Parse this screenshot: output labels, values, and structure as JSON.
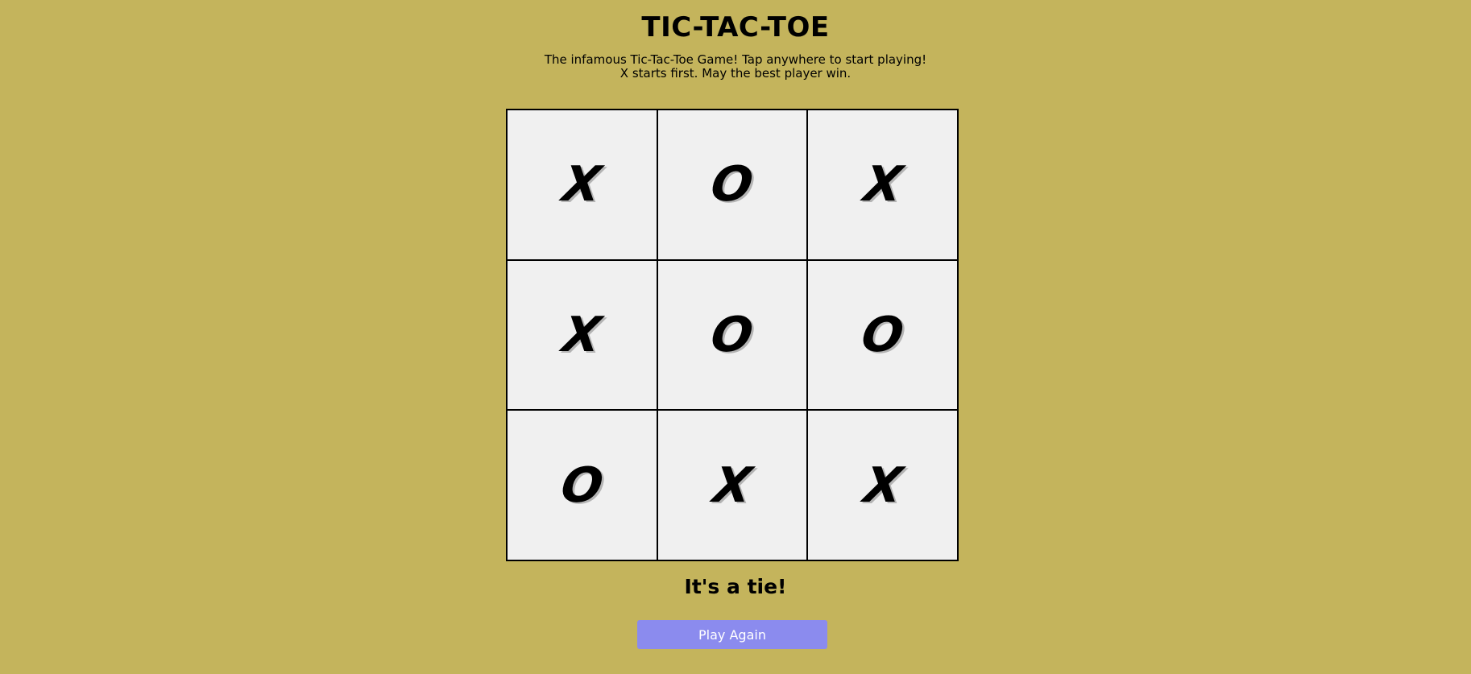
{
  "header": {
    "title": "TIC-TAC-TOE",
    "subtitle_line1": "The infamous Tic-Tac-Toe Game! Tap anywhere to start playing!",
    "subtitle_line2": "X starts first. May the best player win."
  },
  "board": {
    "cells": [
      "X",
      "O",
      "X",
      "X",
      "O",
      "O",
      "O",
      "X",
      "X"
    ]
  },
  "status": {
    "message": "It's a tie!"
  },
  "actions": {
    "play_again_label": "Play Again"
  },
  "colors": {
    "background": "#c4b45c",
    "cell": "#f0f0f0",
    "button": "#8b8bee",
    "button_text": "#ffffff"
  }
}
